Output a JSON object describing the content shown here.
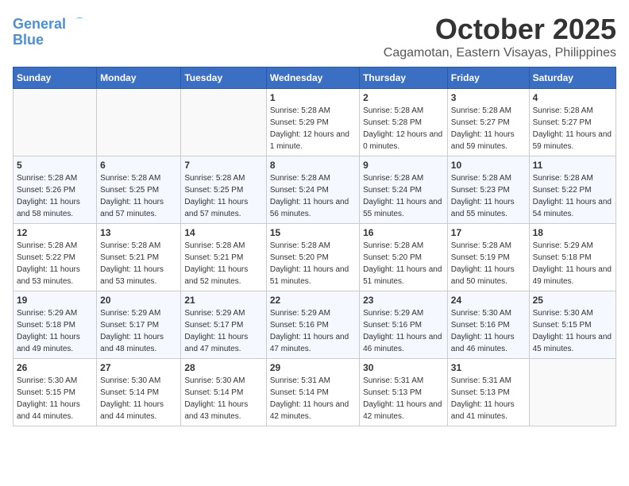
{
  "header": {
    "logo_line1": "General",
    "logo_line2": "Blue",
    "month": "October 2025",
    "location": "Cagamotan, Eastern Visayas, Philippines"
  },
  "weekdays": [
    "Sunday",
    "Monday",
    "Tuesday",
    "Wednesday",
    "Thursday",
    "Friday",
    "Saturday"
  ],
  "weeks": [
    [
      {
        "day": "",
        "sunrise": "",
        "sunset": "",
        "daylight": ""
      },
      {
        "day": "",
        "sunrise": "",
        "sunset": "",
        "daylight": ""
      },
      {
        "day": "",
        "sunrise": "",
        "sunset": "",
        "daylight": ""
      },
      {
        "day": "1",
        "sunrise": "Sunrise: 5:28 AM",
        "sunset": "Sunset: 5:29 PM",
        "daylight": "Daylight: 12 hours and 1 minute."
      },
      {
        "day": "2",
        "sunrise": "Sunrise: 5:28 AM",
        "sunset": "Sunset: 5:28 PM",
        "daylight": "Daylight: 12 hours and 0 minutes."
      },
      {
        "day": "3",
        "sunrise": "Sunrise: 5:28 AM",
        "sunset": "Sunset: 5:27 PM",
        "daylight": "Daylight: 11 hours and 59 minutes."
      },
      {
        "day": "4",
        "sunrise": "Sunrise: 5:28 AM",
        "sunset": "Sunset: 5:27 PM",
        "daylight": "Daylight: 11 hours and 59 minutes."
      }
    ],
    [
      {
        "day": "5",
        "sunrise": "Sunrise: 5:28 AM",
        "sunset": "Sunset: 5:26 PM",
        "daylight": "Daylight: 11 hours and 58 minutes."
      },
      {
        "day": "6",
        "sunrise": "Sunrise: 5:28 AM",
        "sunset": "Sunset: 5:25 PM",
        "daylight": "Daylight: 11 hours and 57 minutes."
      },
      {
        "day": "7",
        "sunrise": "Sunrise: 5:28 AM",
        "sunset": "Sunset: 5:25 PM",
        "daylight": "Daylight: 11 hours and 57 minutes."
      },
      {
        "day": "8",
        "sunrise": "Sunrise: 5:28 AM",
        "sunset": "Sunset: 5:24 PM",
        "daylight": "Daylight: 11 hours and 56 minutes."
      },
      {
        "day": "9",
        "sunrise": "Sunrise: 5:28 AM",
        "sunset": "Sunset: 5:24 PM",
        "daylight": "Daylight: 11 hours and 55 minutes."
      },
      {
        "day": "10",
        "sunrise": "Sunrise: 5:28 AM",
        "sunset": "Sunset: 5:23 PM",
        "daylight": "Daylight: 11 hours and 55 minutes."
      },
      {
        "day": "11",
        "sunrise": "Sunrise: 5:28 AM",
        "sunset": "Sunset: 5:22 PM",
        "daylight": "Daylight: 11 hours and 54 minutes."
      }
    ],
    [
      {
        "day": "12",
        "sunrise": "Sunrise: 5:28 AM",
        "sunset": "Sunset: 5:22 PM",
        "daylight": "Daylight: 11 hours and 53 minutes."
      },
      {
        "day": "13",
        "sunrise": "Sunrise: 5:28 AM",
        "sunset": "Sunset: 5:21 PM",
        "daylight": "Daylight: 11 hours and 53 minutes."
      },
      {
        "day": "14",
        "sunrise": "Sunrise: 5:28 AM",
        "sunset": "Sunset: 5:21 PM",
        "daylight": "Daylight: 11 hours and 52 minutes."
      },
      {
        "day": "15",
        "sunrise": "Sunrise: 5:28 AM",
        "sunset": "Sunset: 5:20 PM",
        "daylight": "Daylight: 11 hours and 51 minutes."
      },
      {
        "day": "16",
        "sunrise": "Sunrise: 5:28 AM",
        "sunset": "Sunset: 5:20 PM",
        "daylight": "Daylight: 11 hours and 51 minutes."
      },
      {
        "day": "17",
        "sunrise": "Sunrise: 5:28 AM",
        "sunset": "Sunset: 5:19 PM",
        "daylight": "Daylight: 11 hours and 50 minutes."
      },
      {
        "day": "18",
        "sunrise": "Sunrise: 5:29 AM",
        "sunset": "Sunset: 5:18 PM",
        "daylight": "Daylight: 11 hours and 49 minutes."
      }
    ],
    [
      {
        "day": "19",
        "sunrise": "Sunrise: 5:29 AM",
        "sunset": "Sunset: 5:18 PM",
        "daylight": "Daylight: 11 hours and 49 minutes."
      },
      {
        "day": "20",
        "sunrise": "Sunrise: 5:29 AM",
        "sunset": "Sunset: 5:17 PM",
        "daylight": "Daylight: 11 hours and 48 minutes."
      },
      {
        "day": "21",
        "sunrise": "Sunrise: 5:29 AM",
        "sunset": "Sunset: 5:17 PM",
        "daylight": "Daylight: 11 hours and 47 minutes."
      },
      {
        "day": "22",
        "sunrise": "Sunrise: 5:29 AM",
        "sunset": "Sunset: 5:16 PM",
        "daylight": "Daylight: 11 hours and 47 minutes."
      },
      {
        "day": "23",
        "sunrise": "Sunrise: 5:29 AM",
        "sunset": "Sunset: 5:16 PM",
        "daylight": "Daylight: 11 hours and 46 minutes."
      },
      {
        "day": "24",
        "sunrise": "Sunrise: 5:30 AM",
        "sunset": "Sunset: 5:16 PM",
        "daylight": "Daylight: 11 hours and 46 minutes."
      },
      {
        "day": "25",
        "sunrise": "Sunrise: 5:30 AM",
        "sunset": "Sunset: 5:15 PM",
        "daylight": "Daylight: 11 hours and 45 minutes."
      }
    ],
    [
      {
        "day": "26",
        "sunrise": "Sunrise: 5:30 AM",
        "sunset": "Sunset: 5:15 PM",
        "daylight": "Daylight: 11 hours and 44 minutes."
      },
      {
        "day": "27",
        "sunrise": "Sunrise: 5:30 AM",
        "sunset": "Sunset: 5:14 PM",
        "daylight": "Daylight: 11 hours and 44 minutes."
      },
      {
        "day": "28",
        "sunrise": "Sunrise: 5:30 AM",
        "sunset": "Sunset: 5:14 PM",
        "daylight": "Daylight: 11 hours and 43 minutes."
      },
      {
        "day": "29",
        "sunrise": "Sunrise: 5:31 AM",
        "sunset": "Sunset: 5:14 PM",
        "daylight": "Daylight: 11 hours and 42 minutes."
      },
      {
        "day": "30",
        "sunrise": "Sunrise: 5:31 AM",
        "sunset": "Sunset: 5:13 PM",
        "daylight": "Daylight: 11 hours and 42 minutes."
      },
      {
        "day": "31",
        "sunrise": "Sunrise: 5:31 AM",
        "sunset": "Sunset: 5:13 PM",
        "daylight": "Daylight: 11 hours and 41 minutes."
      },
      {
        "day": "",
        "sunrise": "",
        "sunset": "",
        "daylight": ""
      }
    ]
  ]
}
